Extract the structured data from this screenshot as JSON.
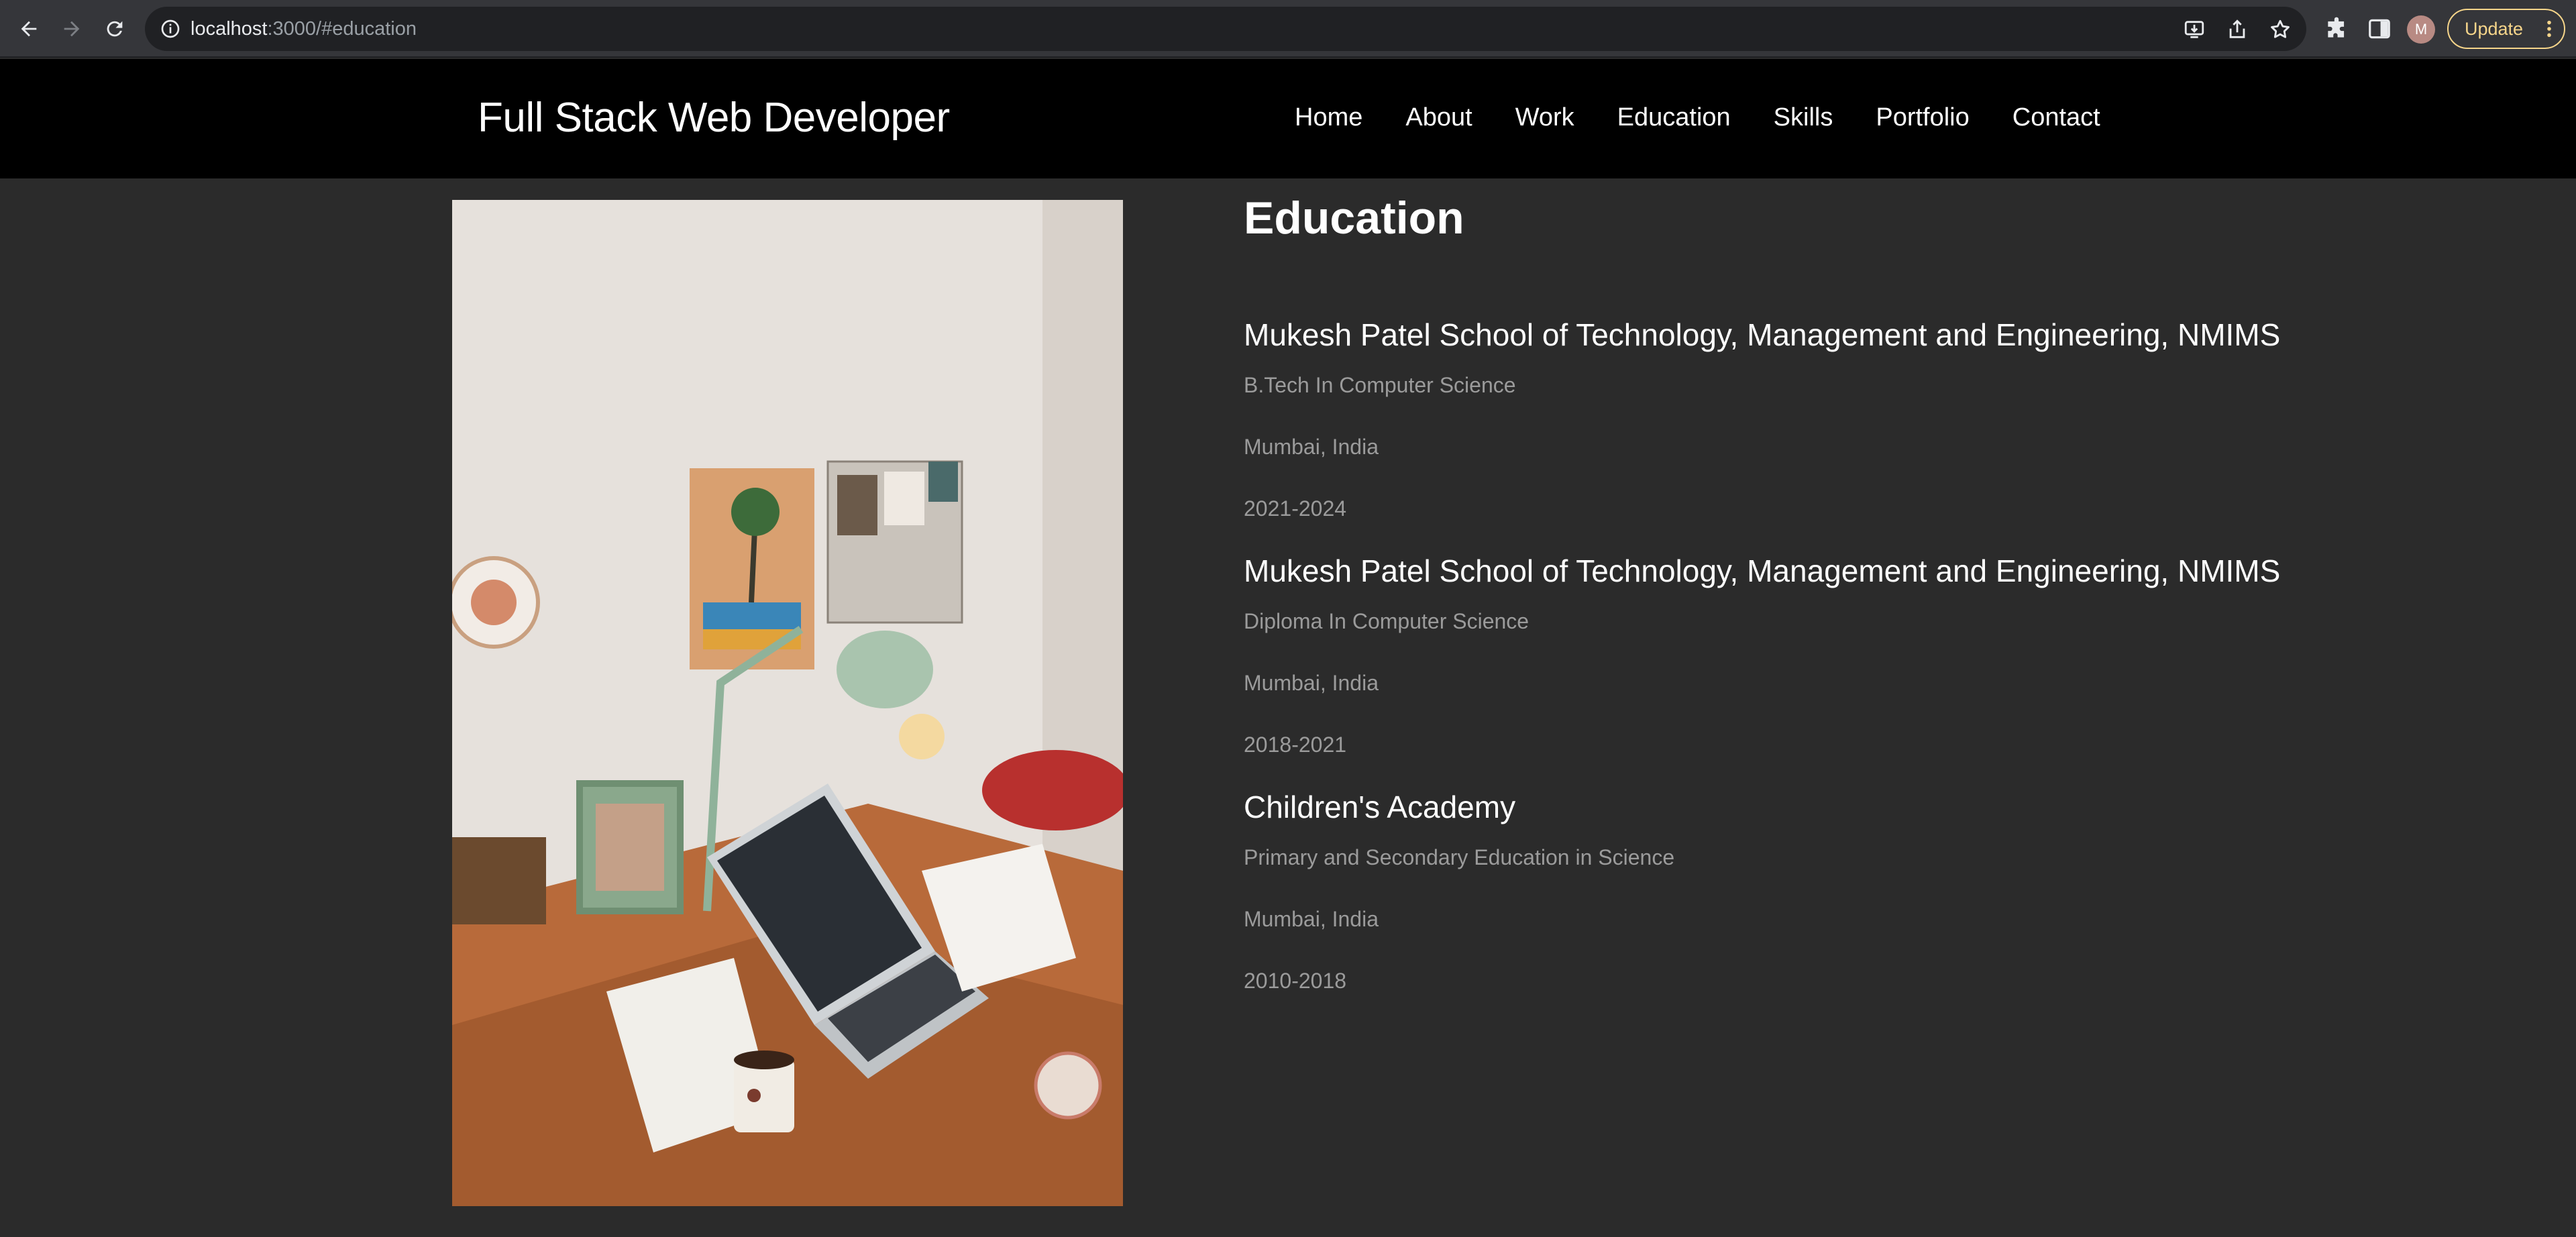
{
  "browser": {
    "url_host": "localhost",
    "url_path": ":3000/#education",
    "avatar_letter": "M",
    "update_label": "Update"
  },
  "header": {
    "brand": "Full Stack Web Developer",
    "nav": [
      "Home",
      "About",
      "Work",
      "Education",
      "Skills",
      "Portfolio",
      "Contact"
    ]
  },
  "education": {
    "title": "Education",
    "entries": [
      {
        "school": "Mukesh Patel School of Technology, Management and Engineering, NMIMS",
        "degree": "B.Tech In Computer Science",
        "location": "Mumbai, India",
        "years": "2021-2024"
      },
      {
        "school": "Mukesh Patel School of Technology, Management and Engineering, NMIMS",
        "degree": "Diploma In Computer Science",
        "location": "Mumbai, India",
        "years": "2018-2021"
      },
      {
        "school": "Children's Academy",
        "degree": "Primary and Secondary Education in Science",
        "location": "Mumbai, India",
        "years": "2010-2018"
      }
    ]
  },
  "colors": {
    "page_bg": "#2b2b2b",
    "header_bg": "#000000",
    "heading_text": "#ffffff",
    "muted_text": "#9b9b9b",
    "update_accent": "#f6d58a"
  }
}
